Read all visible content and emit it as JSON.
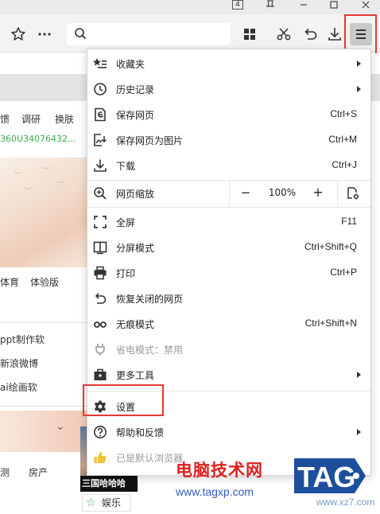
{
  "titlebar": {
    "tab_count": "4",
    "icons": [
      "tab-count-icon",
      "pin-icon",
      "minimize-icon",
      "restore-icon",
      "close-icon"
    ]
  },
  "toolbar": {
    "left_icons": [
      "bookmark-star-icon",
      "more-dots-icon"
    ],
    "search_placeholder": "",
    "right_icons": [
      "apps-grid-icon",
      "scissors-icon",
      "undo-icon",
      "download-icon",
      "menu-icon"
    ]
  },
  "background_page": {
    "nav": [
      "馈",
      "调研",
      "换肤"
    ],
    "green_text": "360U34076432...",
    "sports": [
      "体育",
      "体验版"
    ],
    "side_links": [
      "ppt制作软",
      "新浪微博",
      "ai绘画软"
    ],
    "bottom_nav": [
      "测",
      "房产"
    ],
    "thumb_caption": "三国哈哈哈",
    "entertainment": "娱乐"
  },
  "menu": {
    "items": [
      {
        "label": "收藏夹",
        "icon": "favorites-icon",
        "submenu": true
      },
      {
        "label": "历史记录",
        "icon": "history-icon",
        "submenu": true
      },
      {
        "label": "保存网页",
        "icon": "save-page-icon",
        "shortcut": "Ctrl+S"
      },
      {
        "label": "保存网页为图片",
        "icon": "save-image-icon",
        "shortcut": "Ctrl+M"
      },
      {
        "label": "下载",
        "icon": "download-icon",
        "shortcut": "Ctrl+J"
      },
      {
        "label": "网页缩放",
        "icon": "zoom-icon",
        "zoom_out": "−",
        "zoom_value": "100%",
        "zoom_in": "+",
        "zoom_settings_icon": "zoom-settings-icon"
      },
      {
        "label": "全屏",
        "icon": "fullscreen-icon",
        "shortcut": "F11"
      },
      {
        "label": "分屏模式",
        "icon": "split-screen-icon",
        "shortcut": "Ctrl+Shift+Q"
      },
      {
        "label": "打印",
        "icon": "print-icon",
        "shortcut": "Ctrl+P"
      },
      {
        "label": "恢复关闭的网页",
        "icon": "restore-tab-icon"
      },
      {
        "label": "无痕模式",
        "icon": "incognito-icon",
        "shortcut": "Ctrl+Shift+N"
      },
      {
        "label": "省电模式：禁用",
        "icon": "power-save-icon",
        "disabled": true
      },
      {
        "label": "更多工具",
        "icon": "toolbox-icon",
        "submenu": true
      },
      {
        "label": "设置",
        "icon": "settings-gear-icon"
      },
      {
        "label": "帮助和反馈",
        "icon": "help-icon",
        "submenu": true
      },
      {
        "label": "已是默认浏览器",
        "icon": "thumbs-up-icon",
        "disabled": true
      }
    ]
  },
  "watermark": {
    "title": "电脑技术网",
    "url": "www.tagxp.com",
    "badge": "TAG",
    "site2": "www.xz7.com"
  },
  "colors": {
    "highlight_box": "#e53935",
    "menu_button_bg": "#c9c9c9",
    "green_text": "#3cae4f",
    "watermark_red": "#e02020",
    "watermark_blue": "#1e4f9c"
  }
}
